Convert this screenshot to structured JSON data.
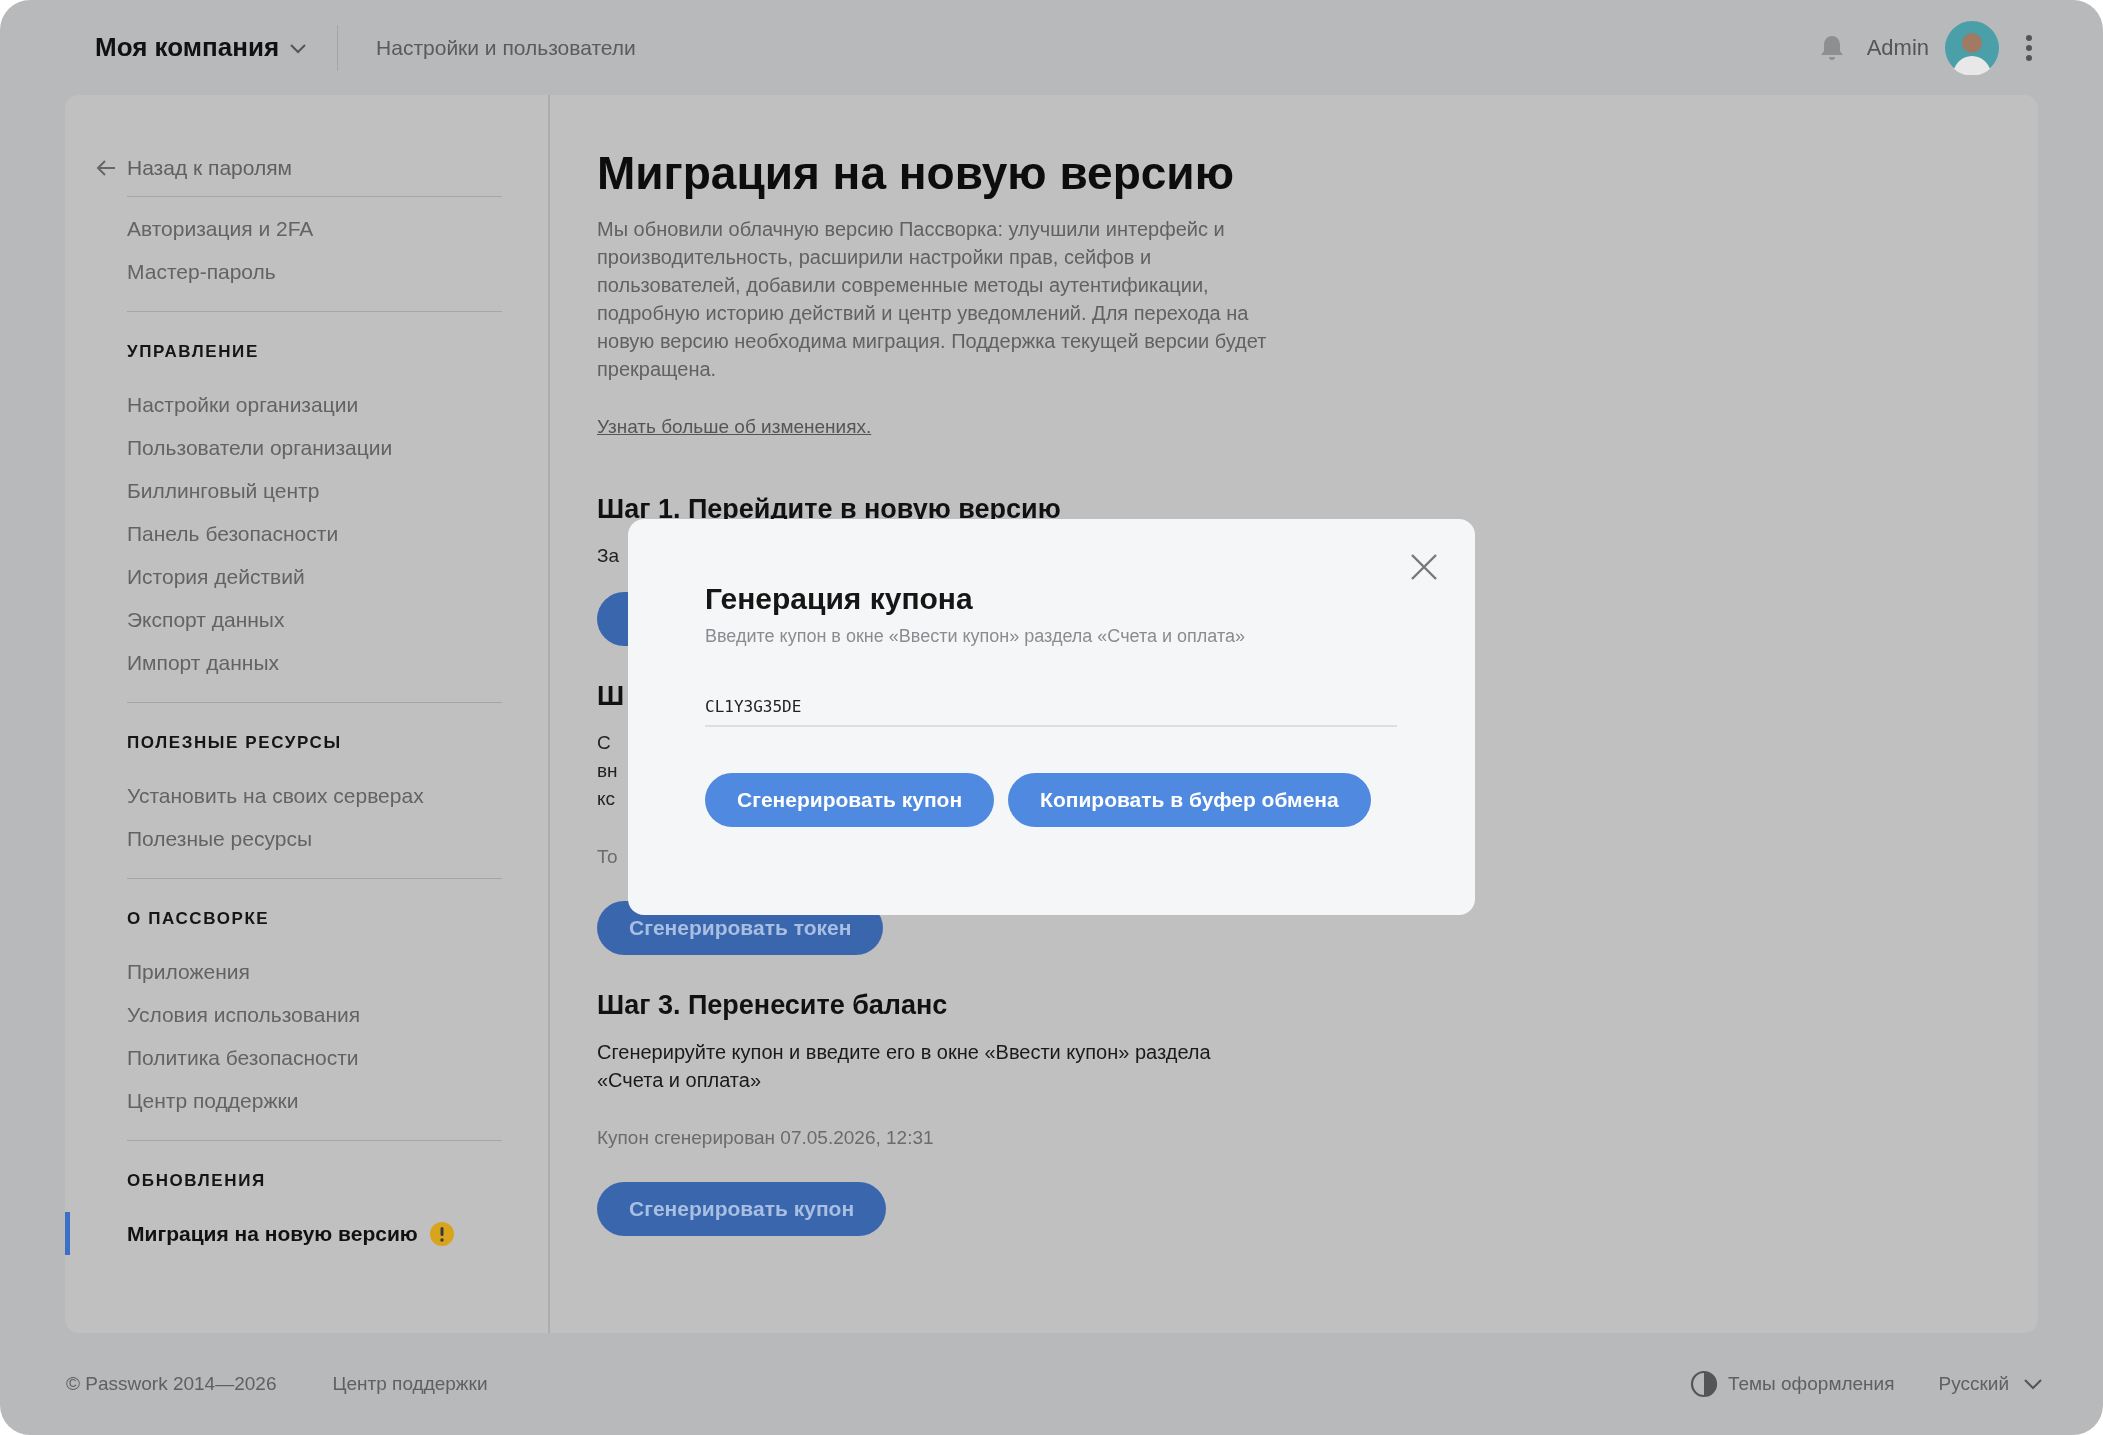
{
  "header": {
    "company": "Моя компания",
    "section": "Настройки и пользователи",
    "user": "Admin"
  },
  "sidebar": {
    "back": "Назад к паролям",
    "groups": [
      {
        "items": [
          {
            "label": "Авторизация и 2FA",
            "selected": false,
            "warning": false
          },
          {
            "label": "Мастер-пароль",
            "selected": false,
            "warning": false
          }
        ]
      },
      {
        "title": "УПРАВЛЕНИЕ",
        "items": [
          {
            "label": "Настройки организации",
            "selected": false,
            "warning": false
          },
          {
            "label": "Пользователи организации",
            "selected": false,
            "warning": false
          },
          {
            "label": "Биллинговый центр",
            "selected": false,
            "warning": false
          },
          {
            "label": "Панель безопасности",
            "selected": false,
            "warning": false
          },
          {
            "label": "История действий",
            "selected": false,
            "warning": false
          },
          {
            "label": "Экспорт данных",
            "selected": false,
            "warning": false
          },
          {
            "label": "Импорт данных",
            "selected": false,
            "warning": false
          }
        ]
      },
      {
        "title": "ПОЛЕЗНЫЕ РЕСУРСЫ",
        "items": [
          {
            "label": "Установить на своих серверах",
            "selected": false,
            "warning": false
          },
          {
            "label": "Полезные ресурсы",
            "selected": false,
            "warning": false
          }
        ]
      },
      {
        "title": "О ПАССВОРКЕ",
        "items": [
          {
            "label": "Приложения",
            "selected": false,
            "warning": false
          },
          {
            "label": "Условия использования",
            "selected": false,
            "warning": false
          },
          {
            "label": "Политика безопасности",
            "selected": false,
            "warning": false
          },
          {
            "label": "Центр поддержки",
            "selected": false,
            "warning": false
          }
        ]
      },
      {
        "title": "ОБНОВЛЕНИЯ",
        "items": [
          {
            "label": "Миграция на новую версию",
            "selected": true,
            "warning": true
          }
        ]
      }
    ]
  },
  "main": {
    "title": "Миграция на новую версию",
    "blocks": [
      {
        "kind": "intro",
        "text": "Мы обновили облачную версию Пассворка: улучшили интерфейс и производительность, расширили настройки прав, сейфов и пользователей, добавили современные методы аутентификации, подробную историю действий и центр уведомлений. Для перехода на новую версию необходима миграция. Поддержка текущей версии будет прекращена."
      },
      {
        "kind": "link",
        "text": "Узнать больше об изменениях."
      },
      {
        "kind": "heading",
        "text": "Шаг 1. Перейдите в новую версию"
      },
      {
        "kind": "text",
        "lines": [
          "За"
        ]
      },
      {
        "kind": "button"
      },
      {
        "kind": "heading",
        "text": "Ш"
      },
      {
        "kind": "text",
        "lines": [
          "С",
          "вн",
          "кс"
        ]
      },
      {
        "kind": "muted",
        "text": "То"
      },
      {
        "kind": "button",
        "text": "Сгенерировать токен"
      },
      {
        "kind": "heading",
        "text": "Шаг 3. Перенесите баланс"
      },
      {
        "kind": "paragraph",
        "text": "Сгенерируйте купон и введите его в окне «Ввести купон» раздела «Счета и оплата»"
      },
      {
        "kind": "muted",
        "text": "Купон сгенерирован 07.05.2026, 12:31"
      },
      {
        "kind": "button",
        "text": "Сгенерировать купон"
      }
    ]
  },
  "modal": {
    "title": "Генерация купона",
    "subtitle": "Введите купон в окне «Ввести купон» раздела «Счета и оплата»",
    "value": "CL1Y3G35DE",
    "buttons": [
      "Сгенерировать купон",
      "Копировать в буфер обмена"
    ]
  },
  "footer": {
    "copyright": "© Passwork 2014—2026",
    "support": "Центр поддержки",
    "themes": "Темы оформления",
    "language": "Русский"
  }
}
